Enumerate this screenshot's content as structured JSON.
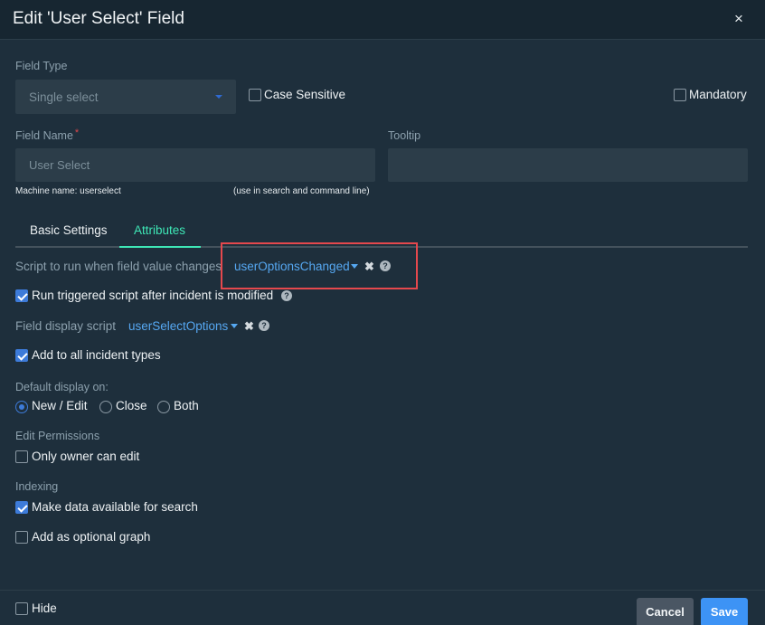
{
  "dialog": {
    "title": "Edit 'User Select' Field",
    "close_symbol": "×"
  },
  "field_type": {
    "label": "Field Type",
    "value": "Single select"
  },
  "case_sensitive": {
    "label": "Case Sensitive",
    "checked": false
  },
  "mandatory": {
    "label": "Mandatory",
    "checked": false
  },
  "field_name": {
    "label": "Field Name",
    "required_mark": "*",
    "value": "User Select",
    "machine_name": "Machine name:  userselect",
    "hint": "(use in search and command line)"
  },
  "tooltip": {
    "label": "Tooltip",
    "value": ""
  },
  "tabs": [
    {
      "label": "Basic Settings",
      "active": false
    },
    {
      "label": "Attributes",
      "active": true
    }
  ],
  "attributes": {
    "script_on_change": {
      "label": "Script to run when field value changes",
      "value": "userOptionsChanged"
    },
    "run_after_modified": {
      "label": "Run triggered script after incident is modified",
      "checked": true
    },
    "display_script": {
      "label": "Field display script",
      "value": "userSelectOptions"
    },
    "add_all_types": {
      "label": "Add to all incident types",
      "checked": true
    },
    "default_display": {
      "label": "Default display on:",
      "options": [
        "New / Edit",
        "Close",
        "Both"
      ],
      "selected": "New / Edit"
    },
    "edit_permissions": {
      "label": "Edit Permissions",
      "only_owner": {
        "label": "Only owner can edit",
        "checked": false
      }
    },
    "indexing": {
      "label": "Indexing",
      "searchable": {
        "label": "Make data available for search",
        "checked": true
      }
    },
    "optional_graph": {
      "label": "Add as optional graph",
      "checked": false
    }
  },
  "footer": {
    "hide": {
      "label": "Hide",
      "checked": false
    },
    "cancel_label": "Cancel",
    "save_label": "Save"
  },
  "icons": {
    "clear_symbol": "✖",
    "help_symbol": "?"
  },
  "colors": {
    "background": "#1e2f3c",
    "header": "#172631",
    "accent_tab": "#3ee7b6",
    "link": "#56a8f2",
    "checkbox": "#3d7bd9",
    "highlight": "#e5484d",
    "save_button": "#3d93f5",
    "cancel_button": "#4a5663"
  }
}
